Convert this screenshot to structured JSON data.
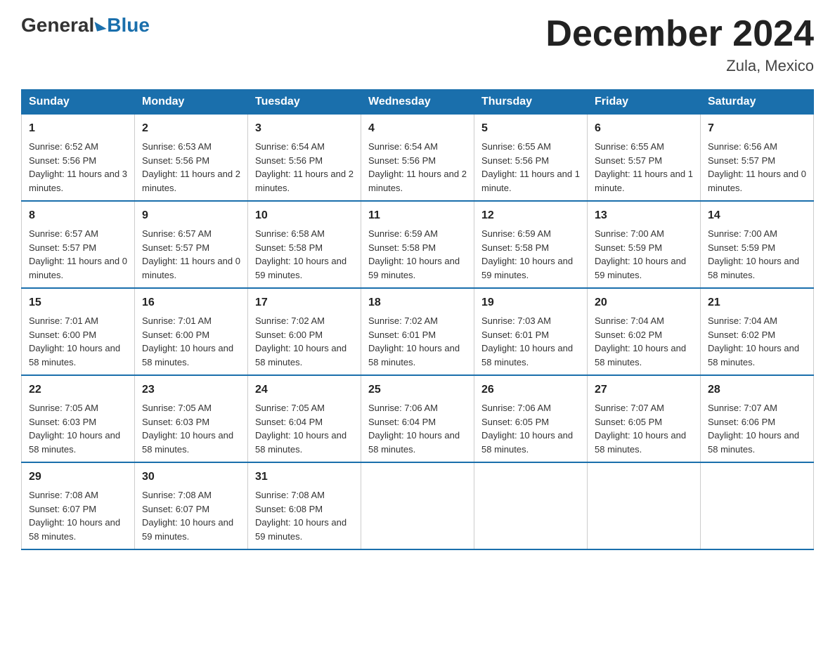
{
  "logo": {
    "general": "General",
    "blue": "Blue"
  },
  "header": {
    "month_year": "December 2024",
    "location": "Zula, Mexico"
  },
  "days_of_week": [
    "Sunday",
    "Monday",
    "Tuesday",
    "Wednesday",
    "Thursday",
    "Friday",
    "Saturday"
  ],
  "weeks": [
    [
      {
        "day": "1",
        "sunrise": "6:52 AM",
        "sunset": "5:56 PM",
        "daylight": "11 hours and 3 minutes."
      },
      {
        "day": "2",
        "sunrise": "6:53 AM",
        "sunset": "5:56 PM",
        "daylight": "11 hours and 2 minutes."
      },
      {
        "day": "3",
        "sunrise": "6:54 AM",
        "sunset": "5:56 PM",
        "daylight": "11 hours and 2 minutes."
      },
      {
        "day": "4",
        "sunrise": "6:54 AM",
        "sunset": "5:56 PM",
        "daylight": "11 hours and 2 minutes."
      },
      {
        "day": "5",
        "sunrise": "6:55 AM",
        "sunset": "5:56 PM",
        "daylight": "11 hours and 1 minute."
      },
      {
        "day": "6",
        "sunrise": "6:55 AM",
        "sunset": "5:57 PM",
        "daylight": "11 hours and 1 minute."
      },
      {
        "day": "7",
        "sunrise": "6:56 AM",
        "sunset": "5:57 PM",
        "daylight": "11 hours and 0 minutes."
      }
    ],
    [
      {
        "day": "8",
        "sunrise": "6:57 AM",
        "sunset": "5:57 PM",
        "daylight": "11 hours and 0 minutes."
      },
      {
        "day": "9",
        "sunrise": "6:57 AM",
        "sunset": "5:57 PM",
        "daylight": "11 hours and 0 minutes."
      },
      {
        "day": "10",
        "sunrise": "6:58 AM",
        "sunset": "5:58 PM",
        "daylight": "10 hours and 59 minutes."
      },
      {
        "day": "11",
        "sunrise": "6:59 AM",
        "sunset": "5:58 PM",
        "daylight": "10 hours and 59 minutes."
      },
      {
        "day": "12",
        "sunrise": "6:59 AM",
        "sunset": "5:58 PM",
        "daylight": "10 hours and 59 minutes."
      },
      {
        "day": "13",
        "sunrise": "7:00 AM",
        "sunset": "5:59 PM",
        "daylight": "10 hours and 59 minutes."
      },
      {
        "day": "14",
        "sunrise": "7:00 AM",
        "sunset": "5:59 PM",
        "daylight": "10 hours and 58 minutes."
      }
    ],
    [
      {
        "day": "15",
        "sunrise": "7:01 AM",
        "sunset": "6:00 PM",
        "daylight": "10 hours and 58 minutes."
      },
      {
        "day": "16",
        "sunrise": "7:01 AM",
        "sunset": "6:00 PM",
        "daylight": "10 hours and 58 minutes."
      },
      {
        "day": "17",
        "sunrise": "7:02 AM",
        "sunset": "6:00 PM",
        "daylight": "10 hours and 58 minutes."
      },
      {
        "day": "18",
        "sunrise": "7:02 AM",
        "sunset": "6:01 PM",
        "daylight": "10 hours and 58 minutes."
      },
      {
        "day": "19",
        "sunrise": "7:03 AM",
        "sunset": "6:01 PM",
        "daylight": "10 hours and 58 minutes."
      },
      {
        "day": "20",
        "sunrise": "7:04 AM",
        "sunset": "6:02 PM",
        "daylight": "10 hours and 58 minutes."
      },
      {
        "day": "21",
        "sunrise": "7:04 AM",
        "sunset": "6:02 PM",
        "daylight": "10 hours and 58 minutes."
      }
    ],
    [
      {
        "day": "22",
        "sunrise": "7:05 AM",
        "sunset": "6:03 PM",
        "daylight": "10 hours and 58 minutes."
      },
      {
        "day": "23",
        "sunrise": "7:05 AM",
        "sunset": "6:03 PM",
        "daylight": "10 hours and 58 minutes."
      },
      {
        "day": "24",
        "sunrise": "7:05 AM",
        "sunset": "6:04 PM",
        "daylight": "10 hours and 58 minutes."
      },
      {
        "day": "25",
        "sunrise": "7:06 AM",
        "sunset": "6:04 PM",
        "daylight": "10 hours and 58 minutes."
      },
      {
        "day": "26",
        "sunrise": "7:06 AM",
        "sunset": "6:05 PM",
        "daylight": "10 hours and 58 minutes."
      },
      {
        "day": "27",
        "sunrise": "7:07 AM",
        "sunset": "6:05 PM",
        "daylight": "10 hours and 58 minutes."
      },
      {
        "day": "28",
        "sunrise": "7:07 AM",
        "sunset": "6:06 PM",
        "daylight": "10 hours and 58 minutes."
      }
    ],
    [
      {
        "day": "29",
        "sunrise": "7:08 AM",
        "sunset": "6:07 PM",
        "daylight": "10 hours and 58 minutes."
      },
      {
        "day": "30",
        "sunrise": "7:08 AM",
        "sunset": "6:07 PM",
        "daylight": "10 hours and 59 minutes."
      },
      {
        "day": "31",
        "sunrise": "7:08 AM",
        "sunset": "6:08 PM",
        "daylight": "10 hours and 59 minutes."
      },
      null,
      null,
      null,
      null
    ]
  ],
  "labels": {
    "sunrise": "Sunrise:",
    "sunset": "Sunset:",
    "daylight": "Daylight:"
  }
}
